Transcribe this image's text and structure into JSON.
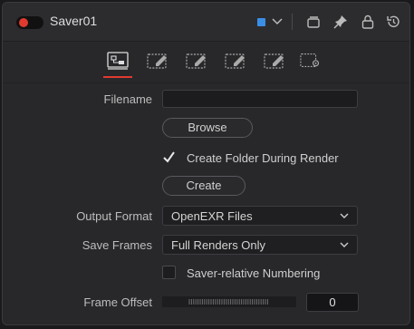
{
  "header": {
    "title": "Saver01",
    "enabled": true,
    "node_color": "#3a8ee6",
    "icons": [
      "chevron-down-icon",
      "versions-icon",
      "pin-icon",
      "lock-icon",
      "reset-icon"
    ]
  },
  "tabs": [
    {
      "name": "tab-file",
      "icon": "file-settings-icon",
      "active": true
    },
    {
      "name": "tab-2",
      "icon": "edit-icon-2"
    },
    {
      "name": "tab-3",
      "icon": "edit-icon-3"
    },
    {
      "name": "tab-4",
      "icon": "edit-icon-4"
    },
    {
      "name": "tab-5",
      "icon": "edit-icon-5"
    },
    {
      "name": "tab-settings",
      "icon": "settings-gear-icon"
    }
  ],
  "form": {
    "filename_label": "Filename",
    "filename_value": "",
    "browse_label": "Browse",
    "create_folder_label": "Create Folder During Render",
    "create_folder_checked": true,
    "create_label": "Create",
    "output_format_label": "Output Format",
    "output_format_value": "OpenEXR Files",
    "save_frames_label": "Save Frames",
    "save_frames_value": "Full Renders Only",
    "saver_relative_label": "Saver-relative Numbering",
    "saver_relative_checked": false,
    "frame_offset_label": "Frame Offset",
    "frame_offset_value": "0"
  },
  "colors": {
    "accent": "#e03a2f",
    "panel": "#28282b"
  }
}
